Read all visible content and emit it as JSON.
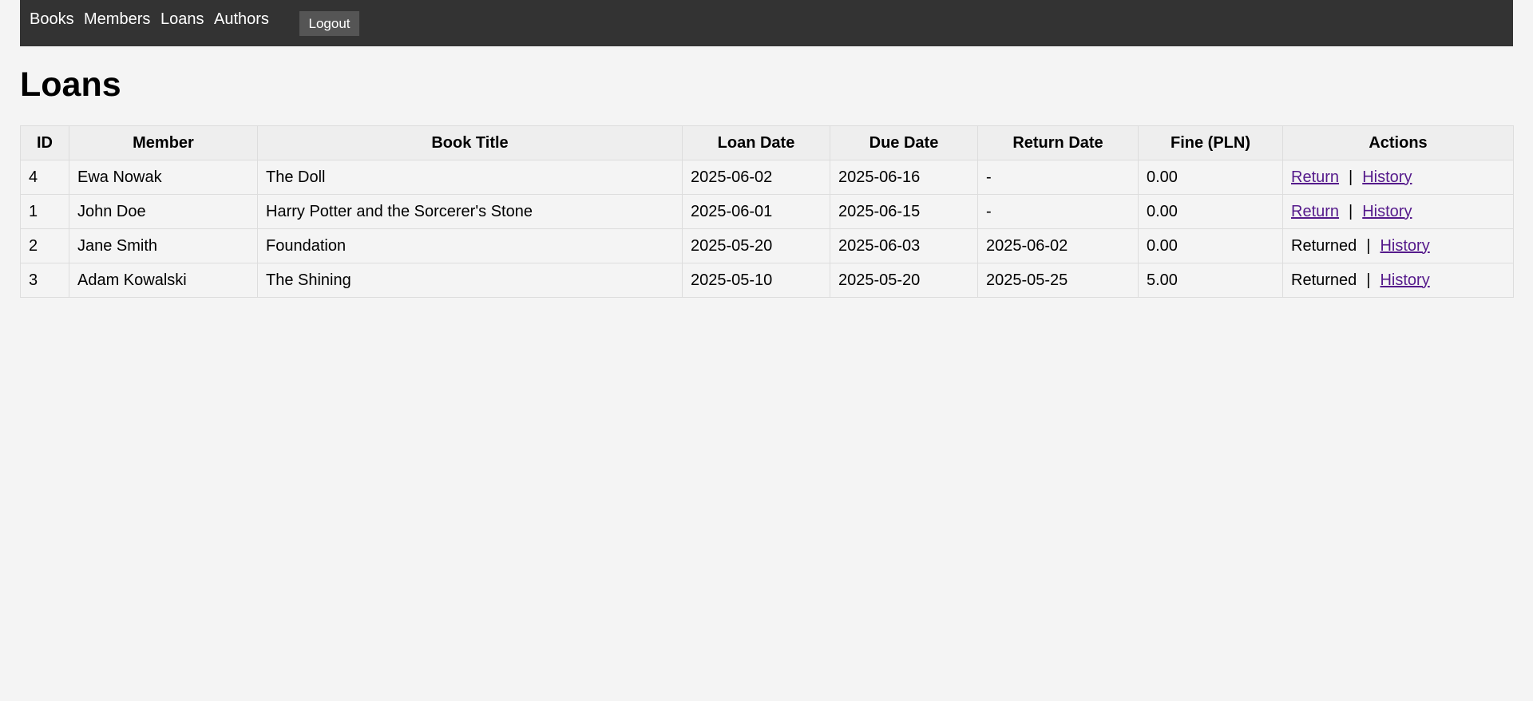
{
  "nav": {
    "links": [
      "Books",
      "Members",
      "Loans",
      "Authors"
    ],
    "logout_label": "Logout"
  },
  "page": {
    "title": "Loans"
  },
  "table": {
    "headers": [
      "ID",
      "Member",
      "Book Title",
      "Loan Date",
      "Due Date",
      "Return Date",
      "Fine (PLN)",
      "Actions"
    ],
    "rows": [
      {
        "id": "4",
        "member": "Ewa Nowak",
        "book": "The Doll",
        "loan_date": "2025-06-02",
        "due_date": "2025-06-16",
        "return_date": "-",
        "fine": "0.00",
        "action_primary": "Return",
        "action_primary_is_link": true,
        "separator": "|",
        "history": "History"
      },
      {
        "id": "1",
        "member": "John Doe",
        "book": "Harry Potter and the Sorcerer's Stone",
        "loan_date": "2025-06-01",
        "due_date": "2025-06-15",
        "return_date": "-",
        "fine": "0.00",
        "action_primary": "Return",
        "action_primary_is_link": true,
        "separator": "|",
        "history": "History"
      },
      {
        "id": "2",
        "member": "Jane Smith",
        "book": "Foundation",
        "loan_date": "2025-05-20",
        "due_date": "2025-06-03",
        "return_date": "2025-06-02",
        "fine": "0.00",
        "action_primary": "Returned",
        "action_primary_is_link": false,
        "separator": "|",
        "history": "History"
      },
      {
        "id": "3",
        "member": "Adam Kowalski",
        "book": "The Shining",
        "loan_date": "2025-05-10",
        "due_date": "2025-05-20",
        "return_date": "2025-05-25",
        "fine": "5.00",
        "action_primary": "Returned",
        "action_primary_is_link": false,
        "separator": "|",
        "history": "History"
      }
    ]
  },
  "colors": {
    "nav_bg": "#333333",
    "logout_bg": "#555555",
    "page_bg": "#f4f4f4",
    "link_visited": "#551a8b"
  }
}
